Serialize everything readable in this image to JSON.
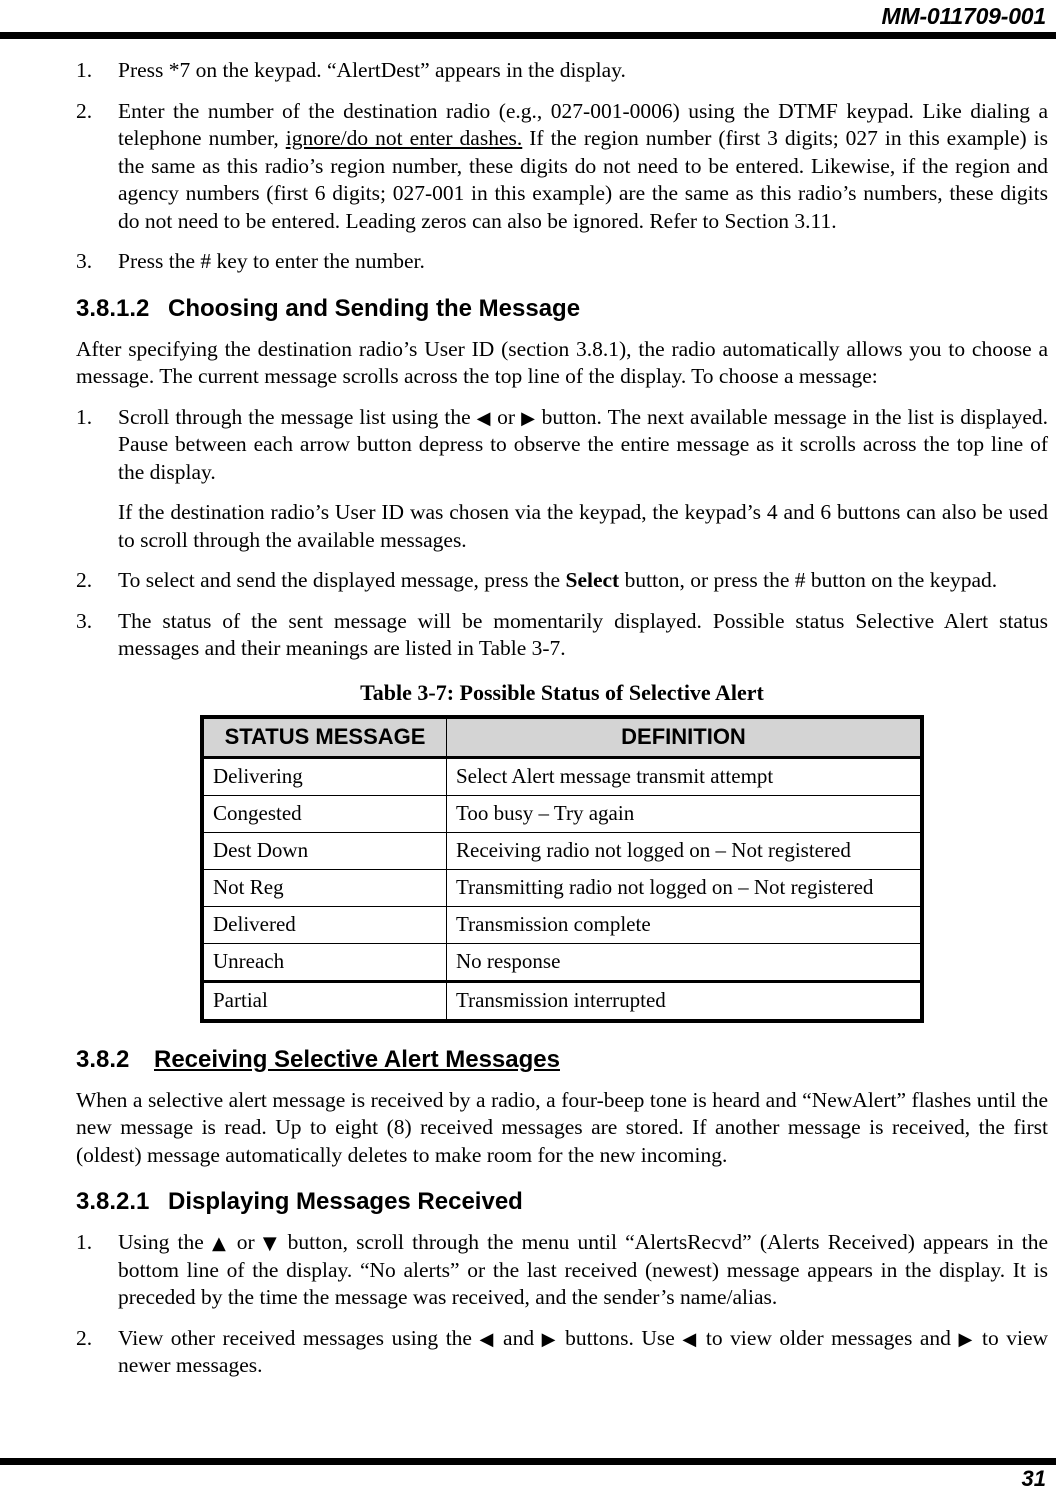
{
  "document": {
    "header_doc_number": "MM-011709-001",
    "page_number": "31"
  },
  "section_381_steps": {
    "step1": {
      "number": "1.",
      "text": "Press *7 on the keypad. “AlertDest” appears in the display."
    },
    "step2": {
      "number": "2.",
      "text_before_underline": "Enter the number of the destination radio (e.g., 027-001-0006) using the DTMF keypad. Like dialing a telephone number, ",
      "underlined_text": "ignore/do not enter dashes.",
      "text_after_underline": " If the region number (first 3 digits; 027 in this example) is the same as this radio’s region number, these digits do not need to be entered. Likewise, if the region and agency numbers (first 6 digits; 027-001 in this example) are the same as this radio’s numbers, these digits do not need to be entered. Leading zeros can also be ignored. Refer to Section 3.11."
    },
    "step3": {
      "number": "3.",
      "text": "Press the # key to enter the number."
    }
  },
  "section_3812": {
    "number": "3.8.1.2",
    "title": "Choosing and Sending the Message",
    "intro": "After specifying the destination radio’s User ID (section 3.8.1), the radio automatically allows you to choose a message. The current message scrolls across the top line of the display. To choose a message:",
    "step1": {
      "number": "1.",
      "part1": "Scroll through the message list using the ",
      "arrow_left": "◀",
      "part2": " or ",
      "arrow_right": "▶",
      "part3": " button. The next available message in the list is displayed. Pause between each arrow button depress to observe the entire message as it scrolls across the top line of the display."
    },
    "step1_note": "If the destination radio’s User ID was chosen via the keypad, the keypad’s 4 and 6 buttons can also be used to scroll through the available messages.",
    "step2": {
      "number": "2.",
      "part1": "To select and send the displayed message, press the ",
      "bold_word": "Select",
      "part2": " button, or press the # button on the keypad."
    },
    "step3": {
      "number": "3.",
      "text": "The status of the sent message will be momentarily displayed. Possible status Selective Alert status messages and their meanings are listed in Table 3-7."
    }
  },
  "table_37": {
    "caption": "Table 3-7: Possible Status of Selective Alert",
    "columns": [
      "STATUS MESSAGE",
      "DEFINITION"
    ],
    "rows": [
      [
        "Delivering",
        "Select Alert message transmit attempt"
      ],
      [
        "Congested",
        "Too busy – Try again"
      ],
      [
        "Dest Down",
        "Receiving radio not logged on – Not registered"
      ],
      [
        "Not Reg",
        "Transmitting radio not logged on – Not registered"
      ],
      [
        "Delivered",
        "Transmission complete"
      ],
      [
        "Unreach",
        "No response"
      ],
      [
        "Partial",
        "Transmission interrupted"
      ]
    ],
    "header_background": "#d4d4d4"
  },
  "section_382": {
    "number": "3.8.2",
    "title": "Receiving Selective Alert Messages",
    "body": "When a selective alert message is received by a radio, a four-beep tone is heard and “NewAlert” flashes until the new message is read. Up to eight (8) received messages are stored. If another message is received, the first (oldest) message automatically deletes to make room for the new incoming."
  },
  "section_3821": {
    "number": "3.8.2.1",
    "title": "Displaying Messages Received",
    "step1": {
      "number": "1.",
      "part1": "Using the ",
      "arrow_up": "▲",
      "part2": " or ",
      "arrow_down": "▼",
      "part3": " button, scroll through the menu until “AlertsRecvd” (Alerts Received) appears in the bottom line of the display. “No alerts” or the last received (newest) message appears in the display. It is preceded by the time the message was received, and the sender’s name/alias."
    },
    "step2": {
      "number": "2.",
      "part1": "View other received messages using the ",
      "arrow_left_1": "◀",
      "part2": " and ",
      "arrow_right_1": "▶",
      "part3": " buttons. Use ",
      "arrow_left_2": "◀",
      "part4": " to view older messages and ",
      "arrow_right_2": "▶",
      "part5": " to view newer messages."
    }
  }
}
